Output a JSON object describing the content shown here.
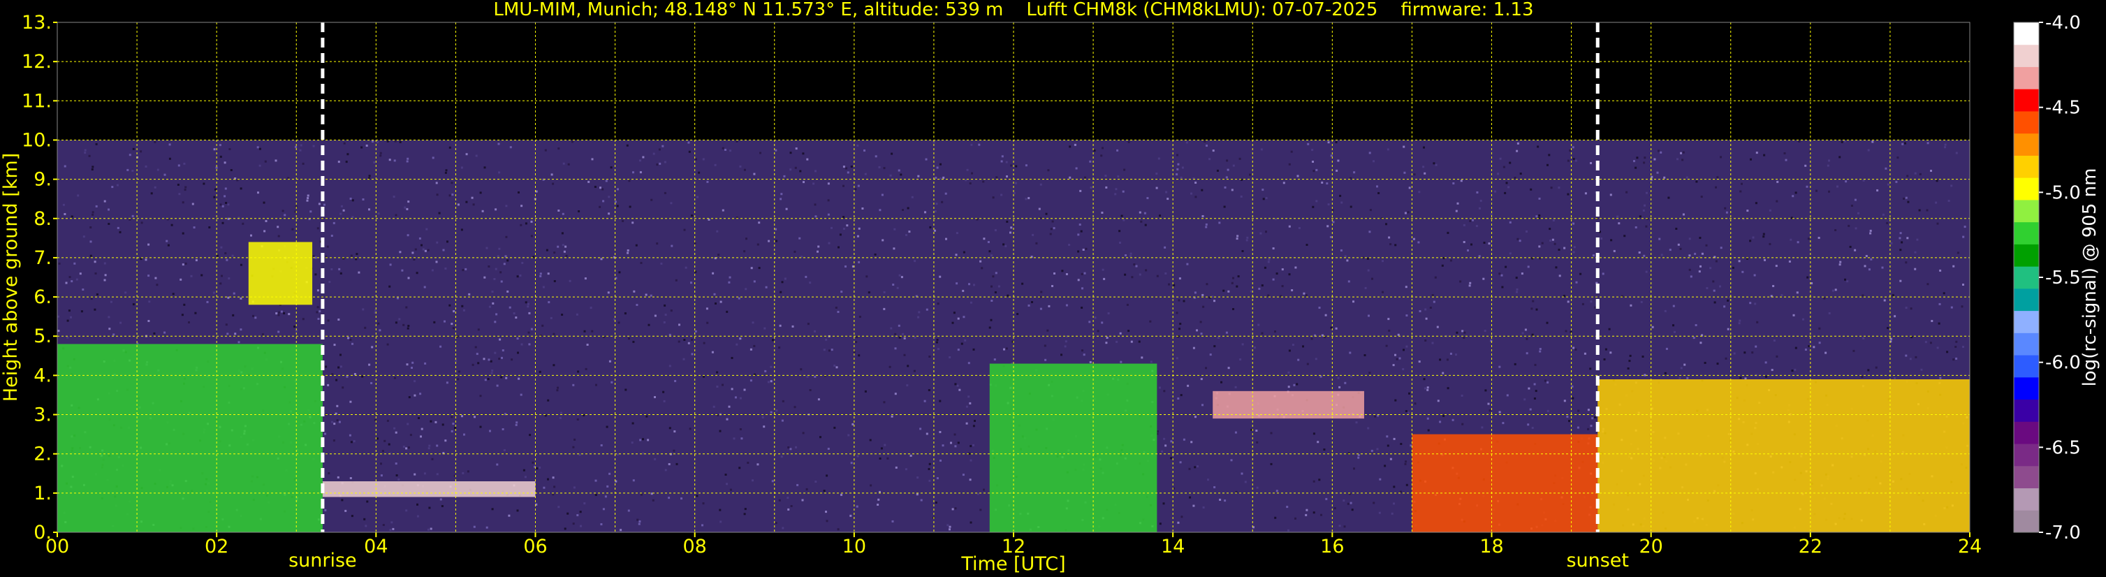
{
  "chart_data": {
    "type": "heatmap",
    "title": "LMU-MIM, Munich; 48.148° N 11.573° E, altitude: 539 m    Lufft CHM8k (CHM8kLMU): 07-07-2025    firmware: 1.13",
    "xlabel": "Time [UTC]",
    "ylabel": "Height above ground [km]",
    "xlim": [
      0,
      24
    ],
    "ylim": [
      0,
      13
    ],
    "x_ticks": [
      "00",
      "02",
      "04",
      "06",
      "08",
      "10",
      "12",
      "14",
      "16",
      "18",
      "20",
      "22",
      "24"
    ],
    "y_ticks": [
      "0.",
      "1.",
      "2.",
      "3.",
      "4.",
      "5.",
      "6.",
      "7.",
      "8.",
      "9.",
      "10.",
      "11.",
      "12.",
      "13."
    ],
    "grid": true,
    "signal_top_km": 10,
    "annotations": [
      {
        "label": "sunrise",
        "x": 3.33
      },
      {
        "label": "sunset",
        "x": 19.33
      }
    ],
    "colorbar": {
      "label": "log(rc-signal) @ 905 nm",
      "min": -7.0,
      "max": -4.0,
      "ticks": [
        "-4.0",
        "-4.5",
        "-5.0",
        "-5.5",
        "-6.0",
        "-6.5",
        "-7.0"
      ],
      "colors": [
        "#a08aa0",
        "#b499b4",
        "#8e4b8e",
        "#7a2a86",
        "#6a0a80",
        "#3a00a6",
        "#0000ff",
        "#2d5cff",
        "#5a88ff",
        "#8fb0ff",
        "#00a0a0",
        "#20c080",
        "#00a000",
        "#30d030",
        "#90f040",
        "#ffff00",
        "#ffd000",
        "#ff9000",
        "#ff5000",
        "#ff0000",
        "#f0a0a0",
        "#f0d0d0",
        "#ffffff"
      ]
    },
    "features": [
      {
        "label": "",
        "x0": 0.0,
        "x1": 3.33,
        "y0": 0.0,
        "y1": 4.8,
        "value": -5.2
      },
      {
        "label": "",
        "x0": 2.4,
        "x1": 3.2,
        "y0": 5.8,
        "y1": 7.4,
        "value": -5.0
      },
      {
        "label": "",
        "x0": 3.33,
        "x1": 6.0,
        "y0": 0.9,
        "y1": 1.3,
        "value": -4.2
      },
      {
        "label": "",
        "x0": 11.7,
        "x1": 13.8,
        "y0": 0.0,
        "y1": 4.3,
        "value": -5.3
      },
      {
        "label": "",
        "x0": 14.5,
        "x1": 16.4,
        "y0": 2.9,
        "y1": 3.6,
        "value": -4.3
      },
      {
        "label": "",
        "x0": 17.0,
        "x1": 19.33,
        "y0": 0.0,
        "y1": 2.5,
        "value": -4.6
      },
      {
        "label": "",
        "x0": 19.33,
        "x1": 24.0,
        "y0": 0.0,
        "y1": 3.9,
        "value": -4.8
      }
    ]
  }
}
